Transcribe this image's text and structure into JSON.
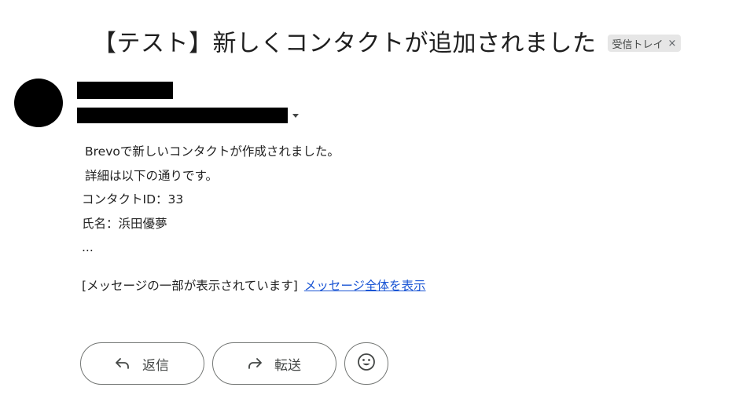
{
  "header": {
    "subject": "【テスト】新しくコンタクトが追加されました",
    "label": "受信トレイ",
    "label_remove": "×"
  },
  "sender": {
    "name": "",
    "email": ""
  },
  "message": {
    "lines": [
      "Brevoで新しいコンタクトが作成されました。",
      "詳細は以下の通りです。",
      "コンタクトID：33",
      "氏名：浜田優夢",
      "..."
    ],
    "clipped_notice": "[メッセージの一部が表示されています]",
    "view_entire_link": "メッセージ全体を表示"
  },
  "actions": {
    "reply_label": "返信",
    "forward_label": "転送"
  },
  "colors": {
    "link": "#1a55d4",
    "chip_bg": "#e6e6e6",
    "button_border": "#747775"
  }
}
